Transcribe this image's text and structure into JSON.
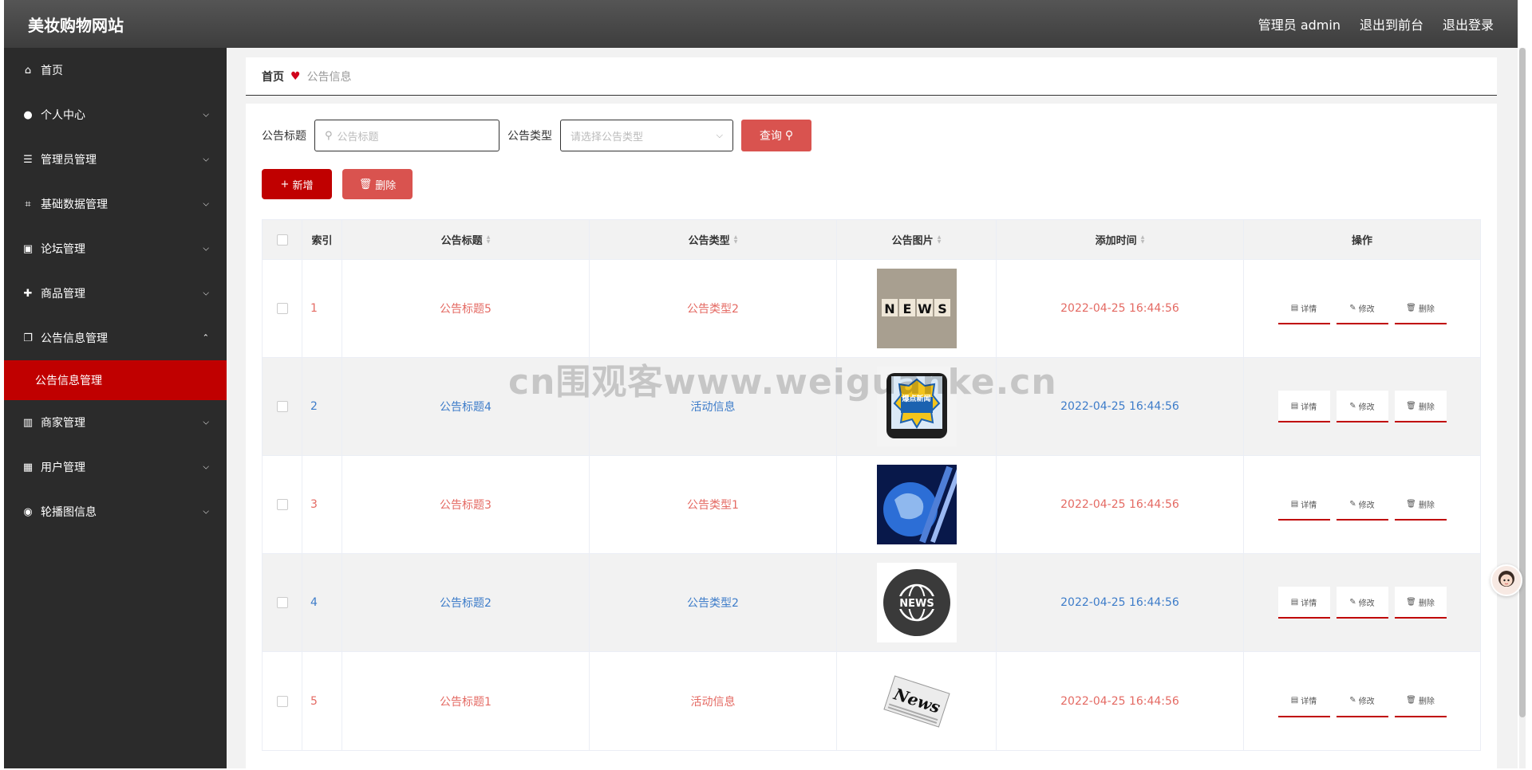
{
  "header": {
    "site_title": "美妆购物网站",
    "admin_label": "管理员 admin",
    "back_front": "退出到前台",
    "logout": "退出登录"
  },
  "sidebar": {
    "items": [
      {
        "label": "首页",
        "icon": "home-icon"
      },
      {
        "label": "个人中心",
        "icon": "user-icon"
      },
      {
        "label": "管理员管理",
        "icon": "list-icon"
      },
      {
        "label": "基础数据管理",
        "icon": "crop-icon"
      },
      {
        "label": "论坛管理",
        "icon": "briefcase-icon"
      },
      {
        "label": "商品管理",
        "icon": "game-icon"
      },
      {
        "label": "公告信息管理",
        "icon": "copy-icon"
      },
      {
        "label": "商家管理",
        "icon": "bar-icon"
      },
      {
        "label": "用户管理",
        "icon": "grid-icon"
      },
      {
        "label": "轮播图信息",
        "icon": "location-icon"
      }
    ],
    "submenu": {
      "label": "公告信息管理"
    }
  },
  "breadcrumb": {
    "home": "首页",
    "current": "公告信息"
  },
  "search": {
    "title_label": "公告标题",
    "title_placeholder": "公告标题",
    "type_label": "公告类型",
    "type_placeholder": "请选择公告类型",
    "query_button": "查询"
  },
  "actions": {
    "add": "新增",
    "delete": "删除"
  },
  "table": {
    "headers": {
      "index": "索引",
      "title": "公告标题",
      "type": "公告类型",
      "image": "公告图片",
      "time": "添加时间",
      "ops": "操作"
    },
    "ops": {
      "detail": "详情",
      "edit": "修改",
      "delete": "删除"
    },
    "rows": [
      {
        "index": "1",
        "title": "公告标题5",
        "type": "公告类型2",
        "time": "2022-04-25 16:44:56",
        "image": "news-blocks"
      },
      {
        "index": "2",
        "title": "公告标题4",
        "type": "活动信息",
        "time": "2022-04-25 16:44:56",
        "image": "hot-news-phone",
        "image_text": "爆点新闻"
      },
      {
        "index": "3",
        "title": "公告标题3",
        "type": "公告类型1",
        "time": "2022-04-25 16:44:56",
        "image": "globe-news"
      },
      {
        "index": "4",
        "title": "公告标题2",
        "type": "公告类型2",
        "time": "2022-04-25 16:44:56",
        "image": "news-globe-circle"
      },
      {
        "index": "5",
        "title": "公告标题1",
        "type": "活动信息",
        "time": "2022-04-25 16:44:56",
        "image": "newspaper"
      }
    ]
  },
  "watermark": "cn围观客www.weiguanke.cn",
  "colors": {
    "accent": "#c00000",
    "danger": "#d9534f",
    "row_red": "#e46a63",
    "row_blue": "#3d7cc9",
    "sidebar": "#2b2b2b"
  }
}
